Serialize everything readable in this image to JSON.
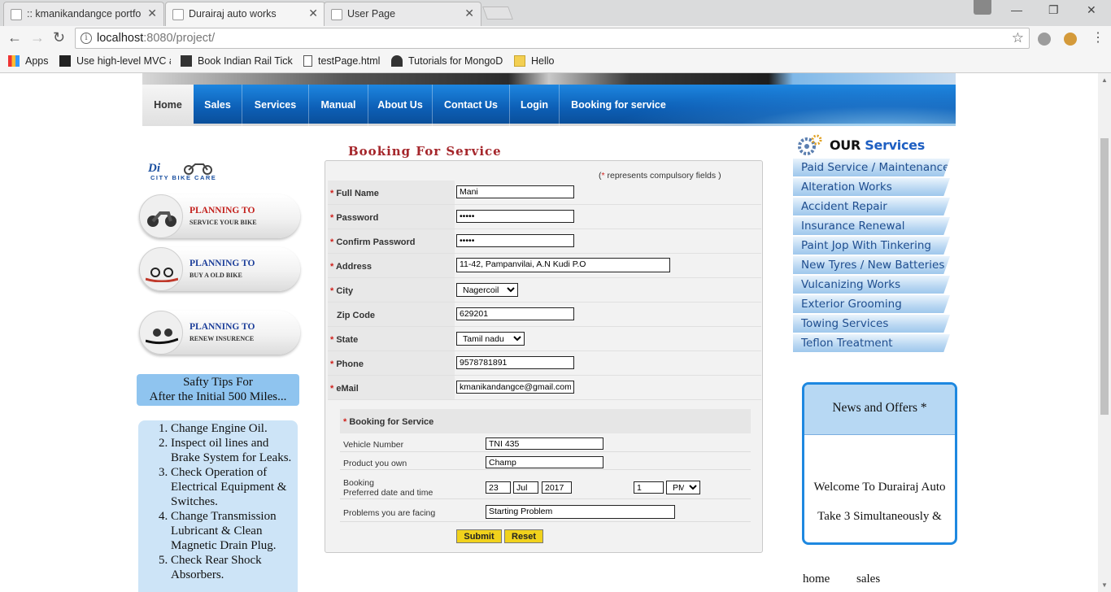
{
  "browser": {
    "tabs": [
      {
        "title": ":: kmanikandangce portfo"
      },
      {
        "title": "Durairaj auto works"
      },
      {
        "title": "User Page"
      }
    ],
    "url_host": "localhost",
    "url_path": ":8080/project/",
    "bookmarks": [
      {
        "label": "Apps"
      },
      {
        "label": "Use high-level MVC a"
      },
      {
        "label": "Book Indian Rail Ticke"
      },
      {
        "label": "testPage.html"
      },
      {
        "label": "Tutorials for MongoD"
      },
      {
        "label": "Hello"
      }
    ]
  },
  "site": {
    "nav": [
      "Home",
      "Sales",
      "Services",
      "Manual",
      "About Us",
      "Contact Us",
      "Login",
      "Booking for service"
    ],
    "logo_text": "CITY  BIKE  CARE",
    "promos": [
      {
        "line1": "PLANNING TO",
        "line2": "SERVICE YOUR BIKE"
      },
      {
        "line1": "PLANNING TO",
        "line2": "BUY A OLD BIKE"
      },
      {
        "line1": "PLANNING TO",
        "line2": "RENEW INSURENCE"
      }
    ],
    "tips_title_1": "Safty Tips For",
    "tips_title_2": "After the Initial 500 Miles...",
    "tips": [
      "Change Engine Oil.",
      "Inspect oil lines and Brake System for Leaks.",
      "Check Operation of Electrical Equipment & Switches.",
      "Change Transmission Lubricant & Clean Magnetic Drain Plug.",
      "Check Rear Shock Absorbers."
    ]
  },
  "form": {
    "title": "Booking For Service",
    "compulsory_star": "*",
    "compulsory_note": " represents compulsory fields )",
    "compulsory_open": "(",
    "fields": {
      "full_name": {
        "label": "Full Name",
        "value": "Mani"
      },
      "password": {
        "label": "Password",
        "value": "manim"
      },
      "confirm_password": {
        "label": "Confirm Password",
        "value": "manim"
      },
      "address": {
        "label": "Address",
        "value": "11-42, Pampanvilai, A.N Kudi P.O"
      },
      "city": {
        "label": "City",
        "value": "Nagercoil"
      },
      "zip": {
        "label": "Zip Code",
        "value": "629201"
      },
      "state": {
        "label": "State",
        "value": "Tamil nadu"
      },
      "phone": {
        "label": "Phone",
        "value": "9578781891"
      },
      "email": {
        "label": "eMail",
        "value": "kmanikandangce@gmail.com"
      }
    },
    "required_mark": "*",
    "booking": {
      "heading": "Booking for Service",
      "vehicle_label": "Vehicle Number",
      "vehicle_value": "TNI 435",
      "product_label": "Product you own",
      "product_value": "Champ",
      "date_label_1": "Booking",
      "date_label_2": "Preferred date and time",
      "day": "23",
      "month": "Jul",
      "year": "2017",
      "hour": "1",
      "ampm": "PM",
      "problem_label": "Problems you are facing",
      "problem_value": "Starting Problem"
    },
    "submit_label": "Submit",
    "reset_label": "Reset"
  },
  "services": {
    "head_our": "OUR ",
    "head_services": "Services",
    "items": [
      "Paid Service / Maintenance",
      "Alteration Works",
      "Accident Repair",
      "Insurance Renewal",
      "Paint Jop With Tinkering",
      "New Tyres / New Batteries",
      "Vulcanizing Works",
      "Exterior Grooming",
      "Towing Services",
      "Teflon Treatment"
    ]
  },
  "news": {
    "heading": "News and Offers *",
    "line1": "Welcome To Durairaj Auto",
    "line2": "Take 3 Simultaneously &"
  },
  "footer": {
    "home": "home",
    "sales": "sales"
  },
  "colors": {
    "nav_blue": "#0d5fb6",
    "title_red": "#a5262b",
    "button_yellow": "#f1d21c",
    "service_text": "#1f4e8f"
  }
}
